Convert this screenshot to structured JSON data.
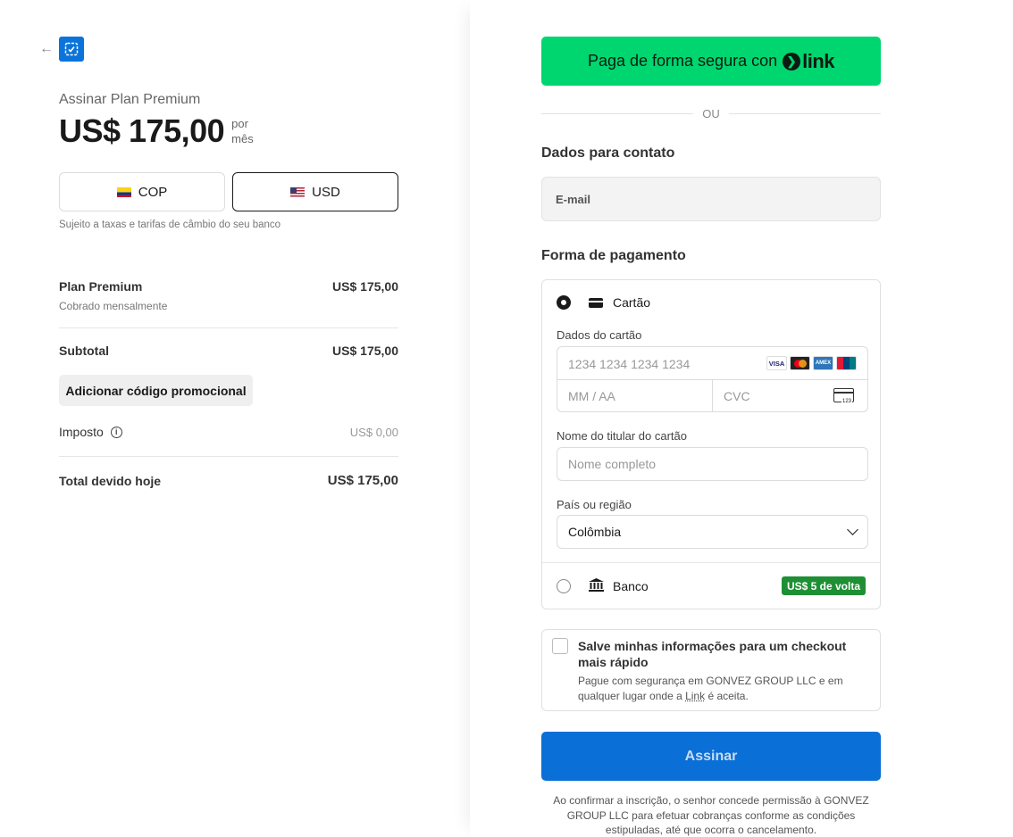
{
  "order": {
    "back_icon": "arrow-left-icon",
    "subscribe_title": "Assinar Plan Premium",
    "price": "US$ 175,00",
    "per_line1": "por",
    "per_line2": "mês",
    "currencies": [
      {
        "code": "COP",
        "flag": "colombia-flag-icon",
        "selected": false
      },
      {
        "code": "USD",
        "flag": "us-flag-icon",
        "selected": true
      }
    ],
    "fx_note": "Sujeito a taxas e tarifas de câmbio do seu banco",
    "line_item": {
      "name": "Plan Premium",
      "sub": "Cobrado mensalmente",
      "amount": "US$ 175,00"
    },
    "subtotal_label": "Subtotal",
    "subtotal_amount": "US$ 175,00",
    "promo_label": "Adicionar código promocional",
    "tax_label": "Imposto",
    "tax_amount": "US$ 0,00",
    "total_label": "Total devido hoje",
    "total_amount": "US$ 175,00"
  },
  "checkout": {
    "link_button_text": "Paga de forma segura con",
    "link_brand": "link",
    "or_text": "OU",
    "contact_title": "Dados para contato",
    "email_placeholder": "E-mail",
    "payment_title": "Forma de pagamento",
    "card_method_label": "Cartão",
    "card_details_label": "Dados do cartão",
    "card_number_placeholder": "1234 1234 1234 1234",
    "card_brands": [
      "VISA",
      "Mastercard",
      "AMEX",
      "UnionPay"
    ],
    "expiry_placeholder": "MM / AA",
    "cvc_placeholder": "CVC",
    "cvc_icon_text": "123",
    "cardholder_label": "Nome do titular do cartão",
    "cardholder_placeholder": "Nome completo",
    "country_label": "País ou região",
    "country_value": "Colômbia",
    "bank_method_label": "Banco",
    "bank_badge": "US$ 5 de volta",
    "save_title": "Salve minhas informações para um checkout mais rápido",
    "save_sub_prefix": "Pague com segurança em GONVEZ GROUP LLC e em qualquer lugar onde a ",
    "save_sub_link": "Link",
    "save_sub_suffix": " é aceita.",
    "submit_label": "Assinar",
    "terms": "Ao confirmar a inscrição, o senhor concede permissão à GONVEZ GROUP LLC para efetuar cobranças conforme as condições estipuladas, até que ocorra o cancelamento."
  },
  "colors": {
    "link_green": "#00d66f",
    "submit_blue": "#0a6fd6",
    "badge_green": "#1e8f34",
    "logo_blue": "#0a74da"
  }
}
